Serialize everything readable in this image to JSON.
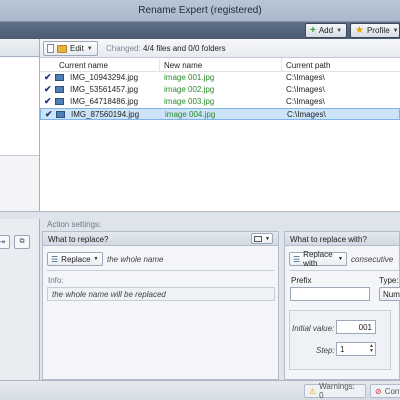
{
  "window": {
    "title": "Rename Expert (registered)"
  },
  "toolbar": {
    "add_label": "Add",
    "profile_label": "Profile"
  },
  "list_toolbar": {
    "edit_label": "Edit",
    "changed_label": "Changed:",
    "changed_value": "4/4 files and 0/0 folders"
  },
  "file_list": {
    "columns": [
      "Current name",
      "New name",
      "Current path"
    ],
    "rows": [
      {
        "current": "IMG_10943294.jpg",
        "new": "image 001.jpg",
        "path": "C:\\Images\\",
        "checked": true,
        "selected": false
      },
      {
        "current": "IMG_53561457.jpg",
        "new": "image 002.jpg",
        "path": "C:\\Images\\",
        "checked": true,
        "selected": false
      },
      {
        "current": "IMG_64718486.jpg",
        "new": "image 003.jpg",
        "path": "C:\\Images\\",
        "checked": true,
        "selected": false
      },
      {
        "current": "IMG_87560194.jpg",
        "new": "image 004.jpg",
        "path": "C:\\Images\\",
        "checked": true,
        "selected": true
      }
    ]
  },
  "action_settings": {
    "label": "Action settings:",
    "replace_panel": {
      "title": "What to replace?",
      "combo_label": "Replace",
      "combo_value": "the whole name",
      "info_label": "Info:",
      "info_text": "the whole name will be replaced"
    },
    "with_panel": {
      "title": "What to replace with?",
      "combo_label": "Replace with",
      "combo_value": "consecutive",
      "prefix_label": "Prefix",
      "type_label": "Type:",
      "type_value": "Num",
      "initial_label": "Initial value:",
      "initial_value": "001",
      "step_label": "Step:",
      "step_value": "1"
    }
  },
  "status": {
    "warnings": "Warnings: 0",
    "conflicts": "Confl"
  },
  "colors": {
    "accent": "#4b5b72",
    "new_name": "#2b8a2b",
    "selection": "#cde3f7"
  }
}
